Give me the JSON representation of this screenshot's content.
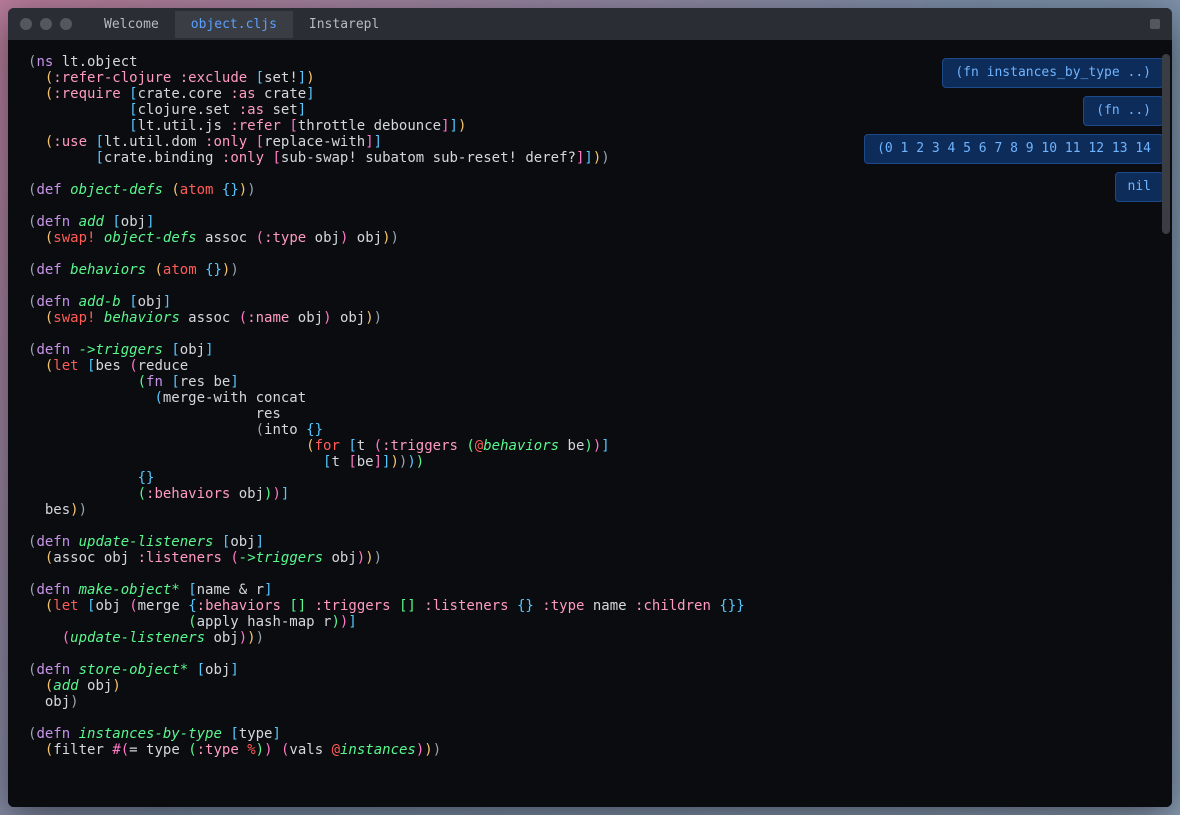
{
  "tabs": [
    {
      "label": "Welcome",
      "active": false
    },
    {
      "label": "object.cljs",
      "active": true
    },
    {
      "label": "Instarepl",
      "active": false
    }
  ],
  "eval_results": [
    "(fn instances_by_type ..)",
    "(fn ..)",
    "(0 1 2 3 4 5 6 7 8 9 10 11 12 13 14",
    "nil"
  ],
  "code_lines": [
    [
      [
        "p",
        "("
      ],
      [
        "kw",
        "ns"
      ],
      [
        "sym",
        " lt.object"
      ]
    ],
    [
      [
        "sym",
        "  "
      ],
      [
        "p2",
        "("
      ],
      [
        "ky",
        ":refer-clojure"
      ],
      [
        "sym",
        " "
      ],
      [
        "ky",
        ":exclude"
      ],
      [
        "sym",
        " "
      ],
      [
        "br",
        "["
      ],
      [
        "sym",
        "set!"
      ],
      [
        "br",
        "]"
      ],
      [
        "p2",
        ")"
      ]
    ],
    [
      [
        "sym",
        "  "
      ],
      [
        "p2",
        "("
      ],
      [
        "ky",
        ":require"
      ],
      [
        "sym",
        " "
      ],
      [
        "br",
        "["
      ],
      [
        "sym",
        "crate.core "
      ],
      [
        "ky",
        ":as"
      ],
      [
        "sym",
        " crate"
      ],
      [
        "br",
        "]"
      ]
    ],
    [
      [
        "sym",
        "            "
      ],
      [
        "br",
        "["
      ],
      [
        "sym",
        "clojure.set "
      ],
      [
        "ky",
        ":as"
      ],
      [
        "sym",
        " set"
      ],
      [
        "br",
        "]"
      ]
    ],
    [
      [
        "sym",
        "            "
      ],
      [
        "br",
        "["
      ],
      [
        "sym",
        "lt.util.js "
      ],
      [
        "ky",
        ":refer"
      ],
      [
        "sym",
        " "
      ],
      [
        "p3",
        "["
      ],
      [
        "sym",
        "throttle debounce"
      ],
      [
        "p3",
        "]"
      ],
      [
        "br",
        "]"
      ],
      [
        "p2",
        ")"
      ]
    ],
    [
      [
        "sym",
        "  "
      ],
      [
        "p2",
        "("
      ],
      [
        "ky",
        ":use"
      ],
      [
        "sym",
        " "
      ],
      [
        "br",
        "["
      ],
      [
        "sym",
        "lt.util.dom "
      ],
      [
        "ky",
        ":only"
      ],
      [
        "sym",
        " "
      ],
      [
        "p3",
        "["
      ],
      [
        "sym",
        "replace-with"
      ],
      [
        "p3",
        "]"
      ],
      [
        "br",
        "]"
      ]
    ],
    [
      [
        "sym",
        "        "
      ],
      [
        "br",
        "["
      ],
      [
        "sym",
        "crate.binding "
      ],
      [
        "ky",
        ":only"
      ],
      [
        "sym",
        " "
      ],
      [
        "p3",
        "["
      ],
      [
        "sym",
        "sub-swap! subatom sub-reset! deref?"
      ],
      [
        "p3",
        "]"
      ],
      [
        "br",
        "]"
      ],
      [
        "p2",
        ")"
      ],
      [
        "p",
        ")"
      ]
    ],
    [
      [
        "sym",
        " "
      ]
    ],
    [
      [
        "p",
        "("
      ],
      [
        "kw",
        "def"
      ],
      [
        "sym",
        " "
      ],
      [
        "fn",
        "object-defs"
      ],
      [
        "sym",
        " "
      ],
      [
        "p2",
        "("
      ],
      [
        "sy",
        "atom"
      ],
      [
        "sym",
        " "
      ],
      [
        "br",
        "{}"
      ],
      [
        "p2",
        ")"
      ],
      [
        "p",
        ")"
      ]
    ],
    [
      [
        "sym",
        " "
      ]
    ],
    [
      [
        "p",
        "("
      ],
      [
        "kw",
        "defn"
      ],
      [
        "sym",
        " "
      ],
      [
        "fn",
        "add"
      ],
      [
        "sym",
        " "
      ],
      [
        "br",
        "["
      ],
      [
        "sym",
        "obj"
      ],
      [
        "br",
        "]"
      ]
    ],
    [
      [
        "sym",
        "  "
      ],
      [
        "p2",
        "("
      ],
      [
        "sy",
        "swap!"
      ],
      [
        "sym",
        " "
      ],
      [
        "fn",
        "object-defs"
      ],
      [
        "sym",
        " assoc "
      ],
      [
        "p3",
        "("
      ],
      [
        "ky",
        ":type"
      ],
      [
        "sym",
        " obj"
      ],
      [
        "p3",
        ")"
      ],
      [
        "sym",
        " obj"
      ],
      [
        "p2",
        ")"
      ],
      [
        "p",
        ")"
      ]
    ],
    [
      [
        "sym",
        " "
      ]
    ],
    [
      [
        "p",
        "("
      ],
      [
        "kw",
        "def"
      ],
      [
        "sym",
        " "
      ],
      [
        "fn",
        "behaviors"
      ],
      [
        "sym",
        " "
      ],
      [
        "p2",
        "("
      ],
      [
        "sy",
        "atom"
      ],
      [
        "sym",
        " "
      ],
      [
        "br",
        "{}"
      ],
      [
        "p2",
        ")"
      ],
      [
        "p",
        ")"
      ]
    ],
    [
      [
        "sym",
        " "
      ]
    ],
    [
      [
        "p",
        "("
      ],
      [
        "kw",
        "defn"
      ],
      [
        "sym",
        " "
      ],
      [
        "fn",
        "add-b"
      ],
      [
        "sym",
        " "
      ],
      [
        "br",
        "["
      ],
      [
        "sym",
        "obj"
      ],
      [
        "br",
        "]"
      ]
    ],
    [
      [
        "sym",
        "  "
      ],
      [
        "p2",
        "("
      ],
      [
        "sy",
        "swap!"
      ],
      [
        "sym",
        " "
      ],
      [
        "fn",
        "behaviors"
      ],
      [
        "sym",
        " assoc "
      ],
      [
        "p3",
        "("
      ],
      [
        "ky",
        ":name"
      ],
      [
        "sym",
        " obj"
      ],
      [
        "p3",
        ")"
      ],
      [
        "sym",
        " obj"
      ],
      [
        "p2",
        ")"
      ],
      [
        "p",
        ")"
      ]
    ],
    [
      [
        "sym",
        " "
      ]
    ],
    [
      [
        "p",
        "("
      ],
      [
        "kw",
        "defn"
      ],
      [
        "sym",
        " "
      ],
      [
        "fn",
        "->triggers"
      ],
      [
        "sym",
        " "
      ],
      [
        "br",
        "["
      ],
      [
        "sym",
        "obj"
      ],
      [
        "br",
        "]"
      ]
    ],
    [
      [
        "sym",
        "  "
      ],
      [
        "p2",
        "("
      ],
      [
        "sy",
        "let"
      ],
      [
        "sym",
        " "
      ],
      [
        "br",
        "["
      ],
      [
        "sym",
        "bes "
      ],
      [
        "p3",
        "("
      ],
      [
        "sym",
        "reduce"
      ]
    ],
    [
      [
        "sym",
        "             "
      ],
      [
        "p4",
        "("
      ],
      [
        "kw",
        "fn"
      ],
      [
        "sym",
        " "
      ],
      [
        "br",
        "["
      ],
      [
        "sym",
        "res be"
      ],
      [
        "br",
        "]"
      ]
    ],
    [
      [
        "sym",
        "               "
      ],
      [
        "p5",
        "("
      ],
      [
        "sym",
        "merge-with concat"
      ]
    ],
    [
      [
        "sym",
        "                           res"
      ]
    ],
    [
      [
        "sym",
        "                           "
      ],
      [
        "p",
        "("
      ],
      [
        "sym",
        "into "
      ],
      [
        "br",
        "{}"
      ]
    ],
    [
      [
        "sym",
        "                                 "
      ],
      [
        "p2",
        "("
      ],
      [
        "sy",
        "for"
      ],
      [
        "sym",
        " "
      ],
      [
        "br",
        "["
      ],
      [
        "sym",
        "t "
      ],
      [
        "p3",
        "("
      ],
      [
        "ky",
        ":triggers"
      ],
      [
        "sym",
        " "
      ],
      [
        "p4",
        "("
      ],
      [
        "sy",
        "@"
      ],
      [
        "fn",
        "behaviors"
      ],
      [
        "sym",
        " be"
      ],
      [
        "p4",
        ")"
      ],
      [
        "p3",
        ")"
      ],
      [
        "br",
        "]"
      ]
    ],
    [
      [
        "sym",
        "                                   "
      ],
      [
        "br",
        "["
      ],
      [
        "sym",
        "t "
      ],
      [
        "p3",
        "["
      ],
      [
        "sym",
        "be"
      ],
      [
        "p3",
        "]"
      ],
      [
        "br",
        "]"
      ],
      [
        "p2",
        ")"
      ],
      [
        "p",
        ")"
      ],
      [
        "p5",
        ")"
      ],
      [
        "p4",
        ")"
      ]
    ],
    [
      [
        "sym",
        "             "
      ],
      [
        "br",
        "{}"
      ]
    ],
    [
      [
        "sym",
        "             "
      ],
      [
        "p4",
        "("
      ],
      [
        "ky",
        ":behaviors"
      ],
      [
        "sym",
        " obj"
      ],
      [
        "p4",
        ")"
      ],
      [
        "p3",
        ")"
      ],
      [
        "br",
        "]"
      ]
    ],
    [
      [
        "sym",
        "  bes"
      ],
      [
        "p2",
        ")"
      ],
      [
        "p",
        ")"
      ]
    ],
    [
      [
        "sym",
        " "
      ]
    ],
    [
      [
        "p",
        "("
      ],
      [
        "kw",
        "defn"
      ],
      [
        "sym",
        " "
      ],
      [
        "fn",
        "update-listeners"
      ],
      [
        "sym",
        " "
      ],
      [
        "br",
        "["
      ],
      [
        "sym",
        "obj"
      ],
      [
        "br",
        "]"
      ]
    ],
    [
      [
        "sym",
        "  "
      ],
      [
        "p2",
        "("
      ],
      [
        "sym",
        "assoc obj "
      ],
      [
        "ky",
        ":listeners"
      ],
      [
        "sym",
        " "
      ],
      [
        "p3",
        "("
      ],
      [
        "fn",
        "->triggers"
      ],
      [
        "sym",
        " obj"
      ],
      [
        "p3",
        ")"
      ],
      [
        "p2",
        ")"
      ],
      [
        "p",
        ")"
      ]
    ],
    [
      [
        "sym",
        " "
      ]
    ],
    [
      [
        "p",
        "("
      ],
      [
        "kw",
        "defn"
      ],
      [
        "sym",
        " "
      ],
      [
        "fn",
        "make-object*"
      ],
      [
        "sym",
        " "
      ],
      [
        "br",
        "["
      ],
      [
        "sym",
        "name & r"
      ],
      [
        "br",
        "]"
      ]
    ],
    [
      [
        "sym",
        "  "
      ],
      [
        "p2",
        "("
      ],
      [
        "sy",
        "let"
      ],
      [
        "sym",
        " "
      ],
      [
        "br",
        "["
      ],
      [
        "sym",
        "obj "
      ],
      [
        "p3",
        "("
      ],
      [
        "sym",
        "merge "
      ],
      [
        "br",
        "{"
      ],
      [
        "ky",
        ":behaviors"
      ],
      [
        "sym",
        " "
      ],
      [
        "p4",
        "[]"
      ],
      [
        "sym",
        " "
      ],
      [
        "ky",
        ":triggers"
      ],
      [
        "sym",
        " "
      ],
      [
        "p4",
        "[]"
      ],
      [
        "sym",
        " "
      ],
      [
        "ky",
        ":listeners"
      ],
      [
        "sym",
        " "
      ],
      [
        "br",
        "{}"
      ],
      [
        "sym",
        " "
      ],
      [
        "ky",
        ":type"
      ],
      [
        "sym",
        " name "
      ],
      [
        "ky",
        ":children"
      ],
      [
        "sym",
        " "
      ],
      [
        "br",
        "{}"
      ],
      [
        "br",
        "}"
      ]
    ],
    [
      [
        "sym",
        "                   "
      ],
      [
        "p4",
        "("
      ],
      [
        "sym",
        "apply hash-map r"
      ],
      [
        "p4",
        ")"
      ],
      [
        "p3",
        ")"
      ],
      [
        "br",
        "]"
      ]
    ],
    [
      [
        "sym",
        "    "
      ],
      [
        "p3",
        "("
      ],
      [
        "fn",
        "update-listeners"
      ],
      [
        "sym",
        " obj"
      ],
      [
        "p3",
        ")"
      ],
      [
        "p2",
        ")"
      ],
      [
        "p",
        ")"
      ]
    ],
    [
      [
        "sym",
        " "
      ]
    ],
    [
      [
        "p",
        "("
      ],
      [
        "kw",
        "defn"
      ],
      [
        "sym",
        " "
      ],
      [
        "fn",
        "store-object*"
      ],
      [
        "sym",
        " "
      ],
      [
        "br",
        "["
      ],
      [
        "sym",
        "obj"
      ],
      [
        "br",
        "]"
      ]
    ],
    [
      [
        "sym",
        "  "
      ],
      [
        "p2",
        "("
      ],
      [
        "fn",
        "add"
      ],
      [
        "sym",
        " obj"
      ],
      [
        "p2",
        ")"
      ]
    ],
    [
      [
        "sym",
        "  obj"
      ],
      [
        "p",
        ")"
      ]
    ],
    [
      [
        "sym",
        " "
      ]
    ],
    [
      [
        "p",
        "("
      ],
      [
        "kw",
        "defn"
      ],
      [
        "sym",
        " "
      ],
      [
        "fn",
        "instances-by-type"
      ],
      [
        "sym",
        " "
      ],
      [
        "br",
        "["
      ],
      [
        "sym",
        "type"
      ],
      [
        "br",
        "]"
      ]
    ],
    [
      [
        "sym",
        "  "
      ],
      [
        "p2",
        "("
      ],
      [
        "sym",
        "filter "
      ],
      [
        "p3",
        "#("
      ],
      [
        "sym",
        "= type "
      ],
      [
        "p4",
        "("
      ],
      [
        "ky",
        ":type"
      ],
      [
        "sym",
        " "
      ],
      [
        "sy",
        "%"
      ],
      [
        "p4",
        ")"
      ],
      [
        "p3",
        ")"
      ],
      [
        "sym",
        " "
      ],
      [
        "p3",
        "("
      ],
      [
        "sym",
        "vals "
      ],
      [
        "sy",
        "@"
      ],
      [
        "fn",
        "instances"
      ],
      [
        "p3",
        ")"
      ],
      [
        "p2",
        ")"
      ],
      [
        "p",
        ")"
      ]
    ]
  ]
}
